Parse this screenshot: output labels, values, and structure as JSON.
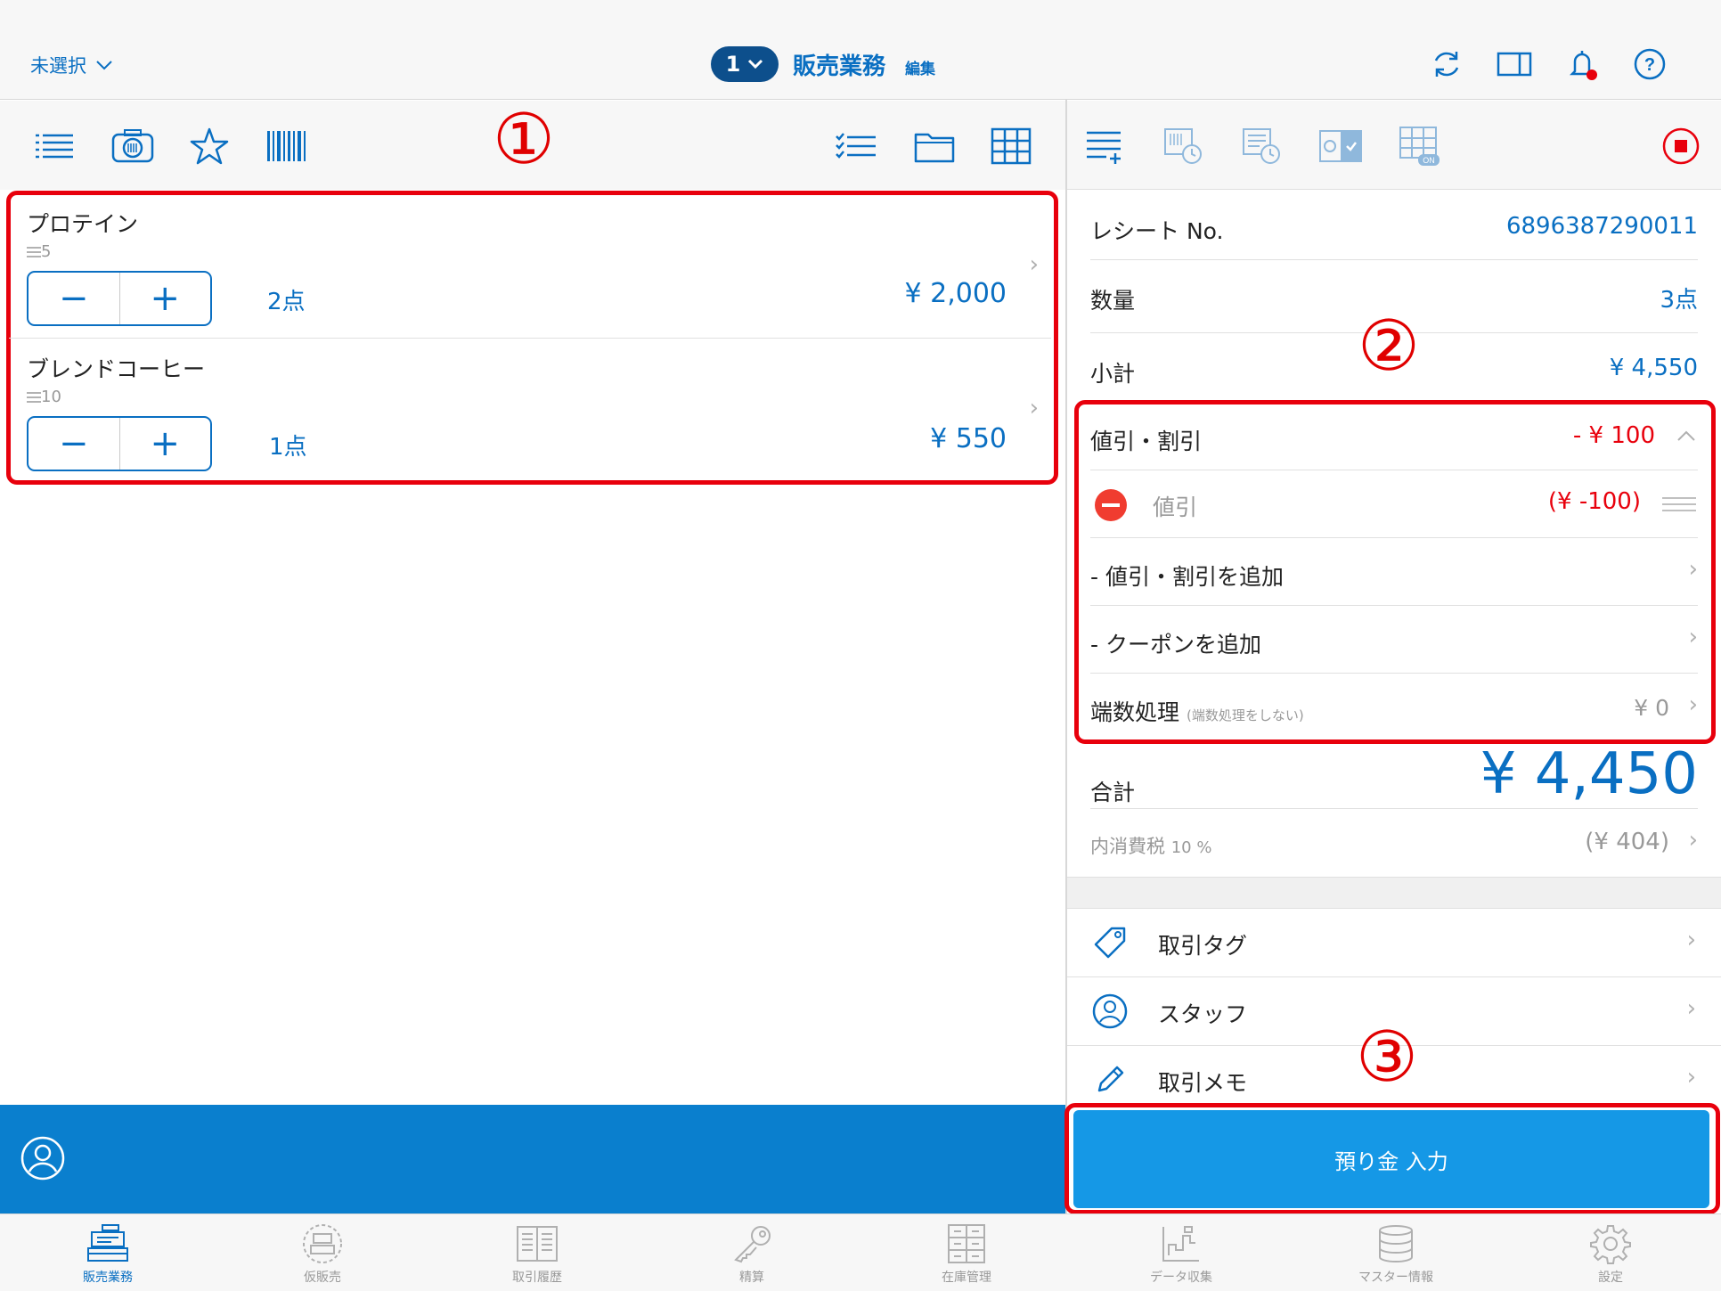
{
  "header": {
    "store_label": "未選択",
    "register_number": "1",
    "title": "販売業務",
    "edit_label": "編集"
  },
  "annotations": {
    "one": "①",
    "two": "②",
    "three": "③"
  },
  "cart": {
    "items": [
      {
        "name": "プロテイン",
        "stock": "5",
        "minus": "−",
        "plus": "+",
        "quantity": "2点",
        "price": "¥ 2,000"
      },
      {
        "name": "ブレンドコーヒー",
        "stock": "10",
        "minus": "−",
        "plus": "+",
        "quantity": "1点",
        "price": "¥ 550"
      }
    ]
  },
  "summary": {
    "receipt_label": "レシート No.",
    "receipt_value": "6896387290011",
    "quantity_label": "数量",
    "quantity_value": "3点",
    "subtotal_label": "小計",
    "subtotal_value": "¥ 4,550",
    "discount_label": "値引・割引",
    "discount_value": "- ¥ 100",
    "discount_item_label": "値引",
    "discount_item_value": "(¥ -100)",
    "add_discount_label": "- 値引・割引を追加",
    "add_coupon_label": "- クーポンを追加",
    "rounding_label": "端数処理",
    "rounding_note": "(端数処理をしない)",
    "rounding_value": "¥ 0",
    "total_label": "合計",
    "total_value": "¥ 4,450",
    "tax_label": "内消費税",
    "tax_rate": "10 %",
    "tax_value": "(¥ 404)"
  },
  "actions": {
    "tag_label": "取引タグ",
    "staff_label": "スタッフ",
    "memo_label": "取引メモ",
    "deposit_button": "預り金 入力"
  },
  "tabs": [
    "販売業務",
    "仮販売",
    "取引履歴",
    "精算",
    "在庫管理",
    "データ収集",
    "マスター情報",
    "設定"
  ],
  "colors": {
    "accent": "#0a6fc2",
    "bar": "#0a7fce",
    "button": "#1598e6",
    "alert": "#e8000c"
  }
}
